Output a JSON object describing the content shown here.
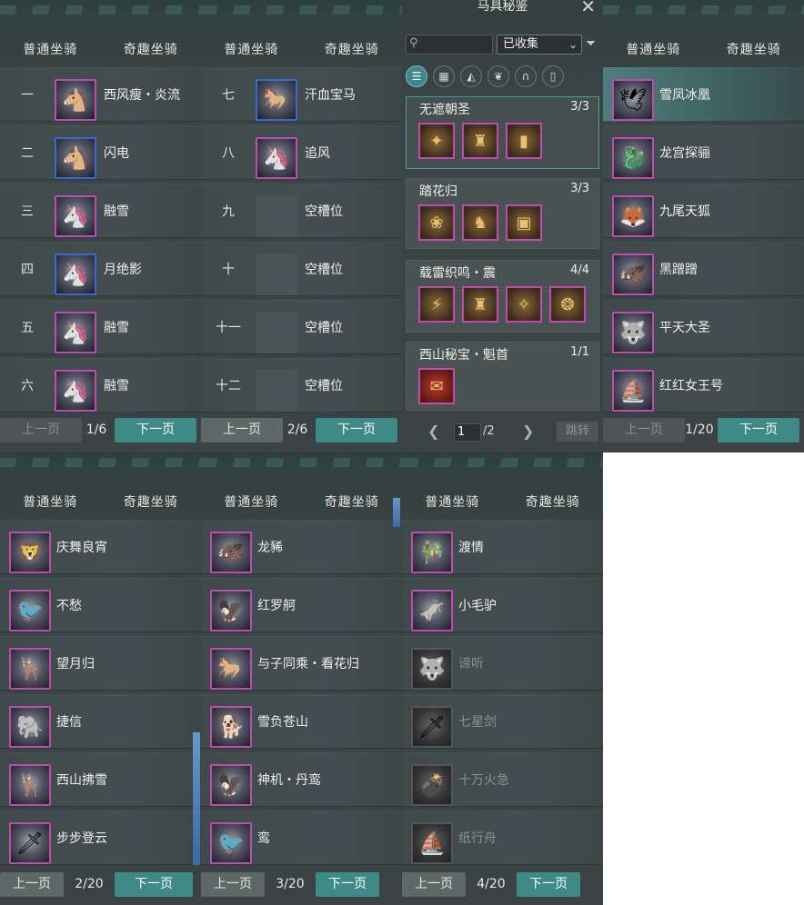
{
  "panels": [
    {
      "tabs": [
        "普通坐骑",
        "奇趣坐骑"
      ],
      "numbered": true,
      "rows": [
        {
          "num": "一",
          "name": "西风瘦・炎流",
          "icon": "horse-black-icon"
        },
        {
          "num": "二",
          "name": "闪电",
          "icon": "horse-black-icon"
        },
        {
          "num": "三",
          "name": "融雪",
          "icon": "horse-white-icon"
        },
        {
          "num": "四",
          "name": "月绝影",
          "icon": "horse-white-icon"
        },
        {
          "num": "五",
          "name": "融雪",
          "icon": "horse-white-icon"
        },
        {
          "num": "六",
          "name": "融雪",
          "icon": "horse-white-icon"
        }
      ],
      "pager": {
        "prev": "上一页",
        "page": "1/6",
        "next": "下一页"
      }
    },
    {
      "tabs": [
        "普通坐骑",
        "奇趣坐骑"
      ],
      "numbered": true,
      "rows": [
        {
          "num": "七",
          "name": "汗血宝马",
          "icon": "horse-brown-icon"
        },
        {
          "num": "八",
          "name": "追风",
          "icon": "horse-white-icon"
        },
        {
          "num": "九",
          "name": "空槽位",
          "icon": "empty-slot-icon"
        },
        {
          "num": "十",
          "name": "空槽位",
          "icon": "empty-slot-icon"
        },
        {
          "num": "十一",
          "name": "空槽位",
          "icon": "empty-slot-icon"
        },
        {
          "num": "十二",
          "name": "空槽位",
          "icon": "empty-slot-icon"
        }
      ],
      "pager": {
        "prev": "上一页",
        "page": "2/6",
        "next": "下一页"
      }
    },
    {
      "tabs": [
        "普通坐骑",
        "奇趣坐骑"
      ],
      "numbered": false,
      "rows": [
        {
          "name": "雪凤冰凰",
          "icon": "phoenix-icon"
        },
        {
          "name": "龙宫探骊",
          "icon": "dragon-icon"
        },
        {
          "name": "九尾天狐",
          "icon": "fox-icon"
        },
        {
          "name": "黑蹭蹭",
          "icon": "pig-icon"
        },
        {
          "name": "平天大圣",
          "icon": "beast-icon"
        },
        {
          "name": "红红女王号",
          "icon": "boat-icon"
        }
      ],
      "pager": {
        "prev": "上一页",
        "page": "1/20",
        "next": "下一页"
      }
    },
    {
      "tabs": [
        "普通坐骑",
        "奇趣坐骑"
      ],
      "numbered": false,
      "rows": [
        {
          "name": "庆舞良宵",
          "icon": "lion-dance-icon"
        },
        {
          "name": "不愁",
          "icon": "bird-icon"
        },
        {
          "name": "望月归",
          "icon": "deer-icon"
        },
        {
          "name": "捷信",
          "icon": "elephant-icon"
        },
        {
          "name": "西山拂雪",
          "icon": "deer-icon"
        },
        {
          "name": "步步登云",
          "icon": "sword-icon"
        }
      ],
      "pager": {
        "prev": "上一页",
        "page": "2/20",
        "next": "下一页"
      }
    },
    {
      "tabs": [
        "普通坐骑",
        "奇趣坐骑"
      ],
      "numbered": false,
      "rows": [
        {
          "name": "龙豨",
          "icon": "boar-icon"
        },
        {
          "name": "红罗舸",
          "icon": "bird-icon"
        },
        {
          "name": "与子同乘・看花归",
          "icon": "horse-white-icon"
        },
        {
          "name": "雪负苍山",
          "icon": "dog-icon"
        },
        {
          "name": "神机・丹鸾",
          "icon": "bird-icon"
        },
        {
          "name": "鸾",
          "icon": "bird-icon"
        }
      ],
      "pager": {
        "prev": "上一页",
        "page": "3/20",
        "next": "下一页"
      }
    },
    {
      "tabs": [
        "普通坐骑",
        "奇趣坐骑"
      ],
      "numbered": false,
      "rows": [
        {
          "name": "渡情",
          "icon": "bamboo-raft-icon",
          "dim": false
        },
        {
          "name": "小毛驴",
          "icon": "donkey-icon",
          "dim": false
        },
        {
          "name": "谛听",
          "icon": "beast-icon",
          "dim": true
        },
        {
          "name": "七星剑",
          "icon": "sword-icon",
          "dim": true
        },
        {
          "name": "十万火急",
          "icon": "bomb-icon",
          "dim": true
        },
        {
          "name": "纸行舟",
          "icon": "paper-boat-icon",
          "dim": true
        }
      ],
      "pager": {
        "prev": "上一页",
        "page": "4/20",
        "next": "下一页"
      }
    }
  ],
  "gear": {
    "title": "马具秘鉴",
    "close": "✕",
    "filter_select": "已收集",
    "groups": [
      {
        "name": "无遮朝圣",
        "count": "3/3",
        "items": 3
      },
      {
        "name": "踏花归",
        "count": "3/3",
        "items": 3
      },
      {
        "name": "载雷织鸣・震",
        "count": "4/4",
        "items": 4
      },
      {
        "name": "西山秘宝・魁首",
        "count": "1/1",
        "items": 1
      }
    ],
    "page_input": "1",
    "page_total": "/2",
    "jump": "跳转"
  }
}
